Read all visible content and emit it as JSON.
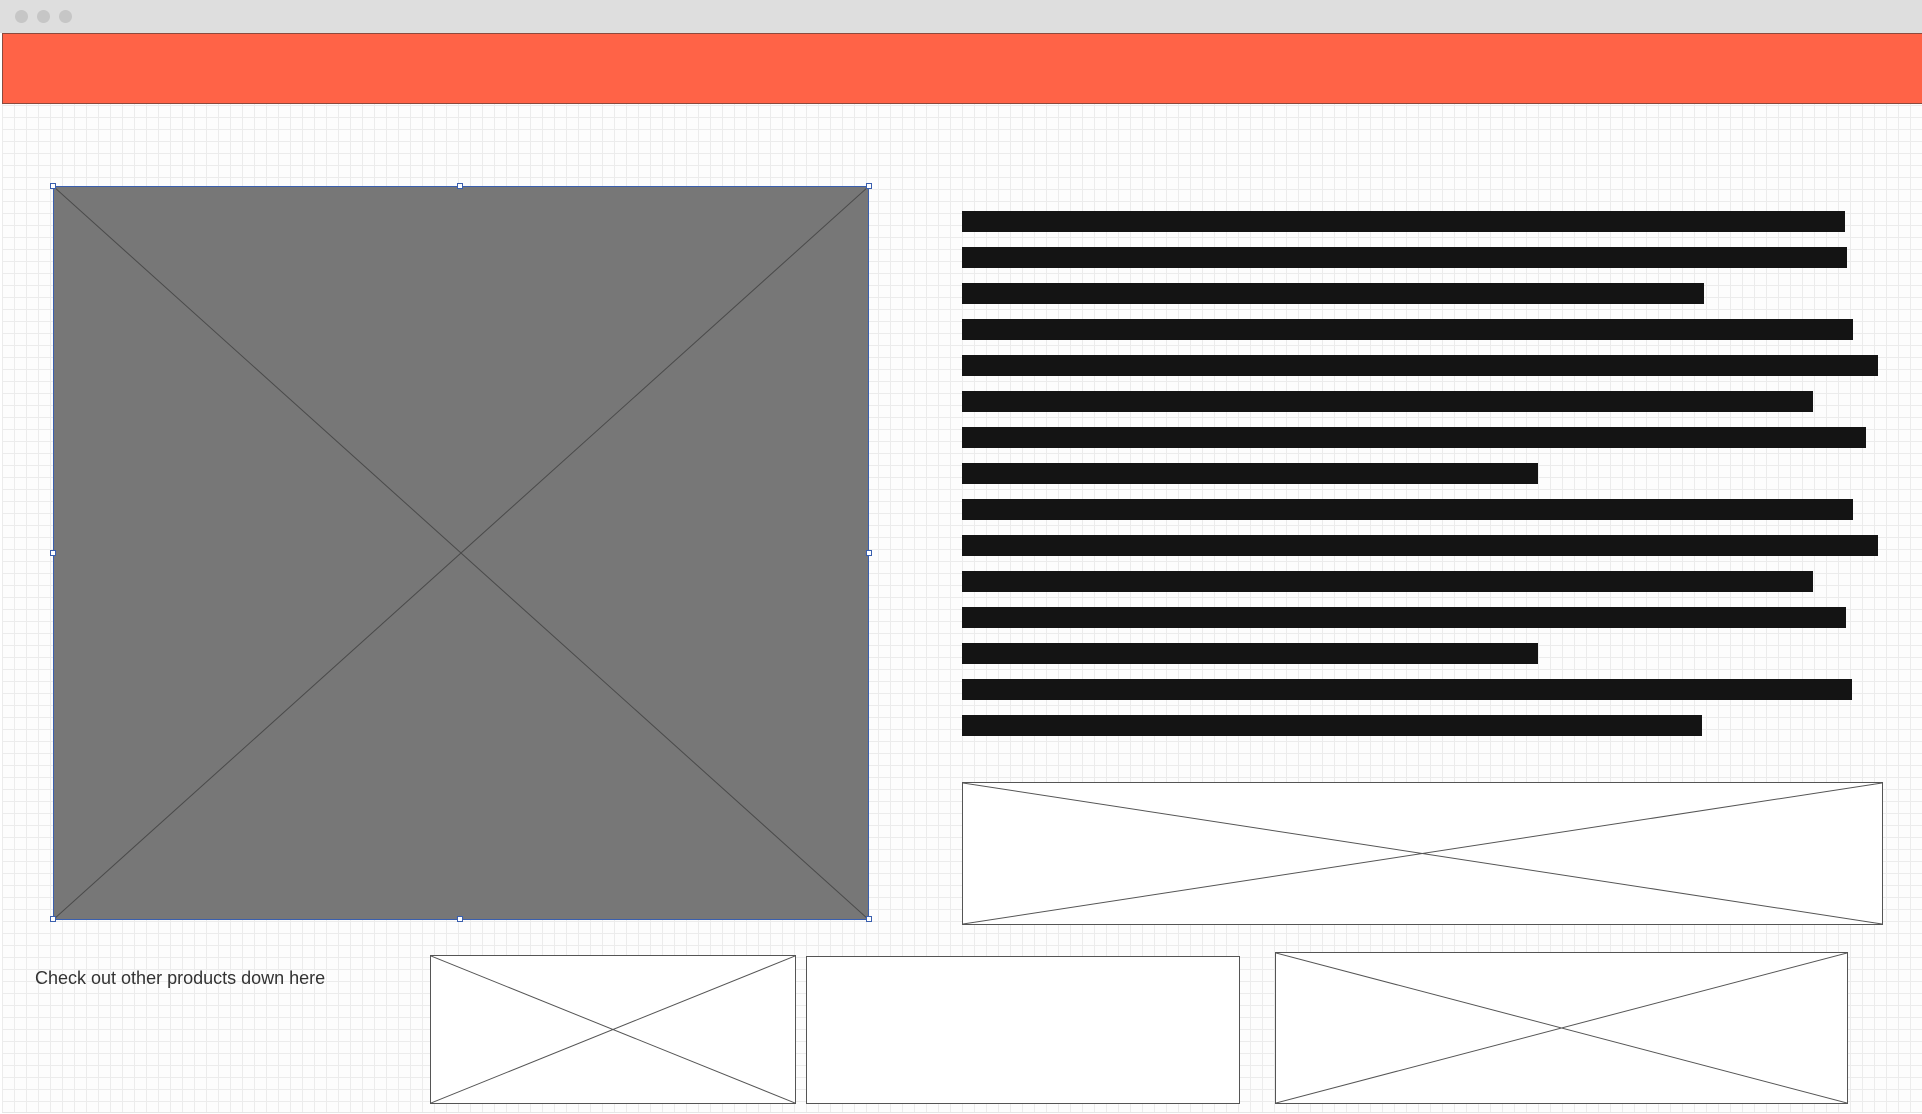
{
  "colors": {
    "header_accent": "#ff6347",
    "image_placeholder": "#777777",
    "text_line": "#141414",
    "selection": "#3a5fae"
  },
  "window": {
    "controls": [
      "close",
      "minimize",
      "maximize"
    ]
  },
  "products": {
    "caption": "Check out other products down here"
  }
}
